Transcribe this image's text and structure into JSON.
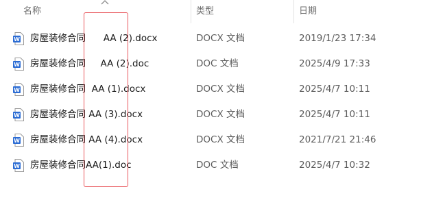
{
  "columns": {
    "name": "名称",
    "type": "类型",
    "date": "日期"
  },
  "sort": {
    "icon": "chevron-up-icon",
    "direction": "ascending"
  },
  "files": [
    {
      "name": "房屋装修合同      AA (2).docx",
      "type": "DOCX 文档",
      "date": "2019/1/23 17:34",
      "icon": "word-docx-icon"
    },
    {
      "name": "房屋装修合同     AA (2).doc",
      "type": "DOC 文档",
      "date": "2025/4/9 17:33",
      "icon": "word-doc-icon"
    },
    {
      "name": "房屋装修合同  AA (1).docx",
      "type": "DOCX 文档",
      "date": "2025/4/7 10:11",
      "icon": "word-docx-icon"
    },
    {
      "name": "房屋装修合同 AA (3).docx",
      "type": "DOCX 文档",
      "date": "2025/4/7 10:11",
      "icon": "word-docx-icon"
    },
    {
      "name": "房屋装修合同 AA (4).docx",
      "type": "DOCX 文档",
      "date": "2021/7/21 21:46",
      "icon": "word-docx-icon"
    },
    {
      "name": "房屋装修合同AA(1).doc",
      "type": "DOC 文档",
      "date": "2025/4/7 10:32",
      "icon": "word-doc-icon"
    }
  ],
  "colors": {
    "header_text": "#6e6e6e",
    "detail_text": "#5c5c5c",
    "word_blue": "#2b6cd4",
    "annotation_red": "#e8545a"
  }
}
